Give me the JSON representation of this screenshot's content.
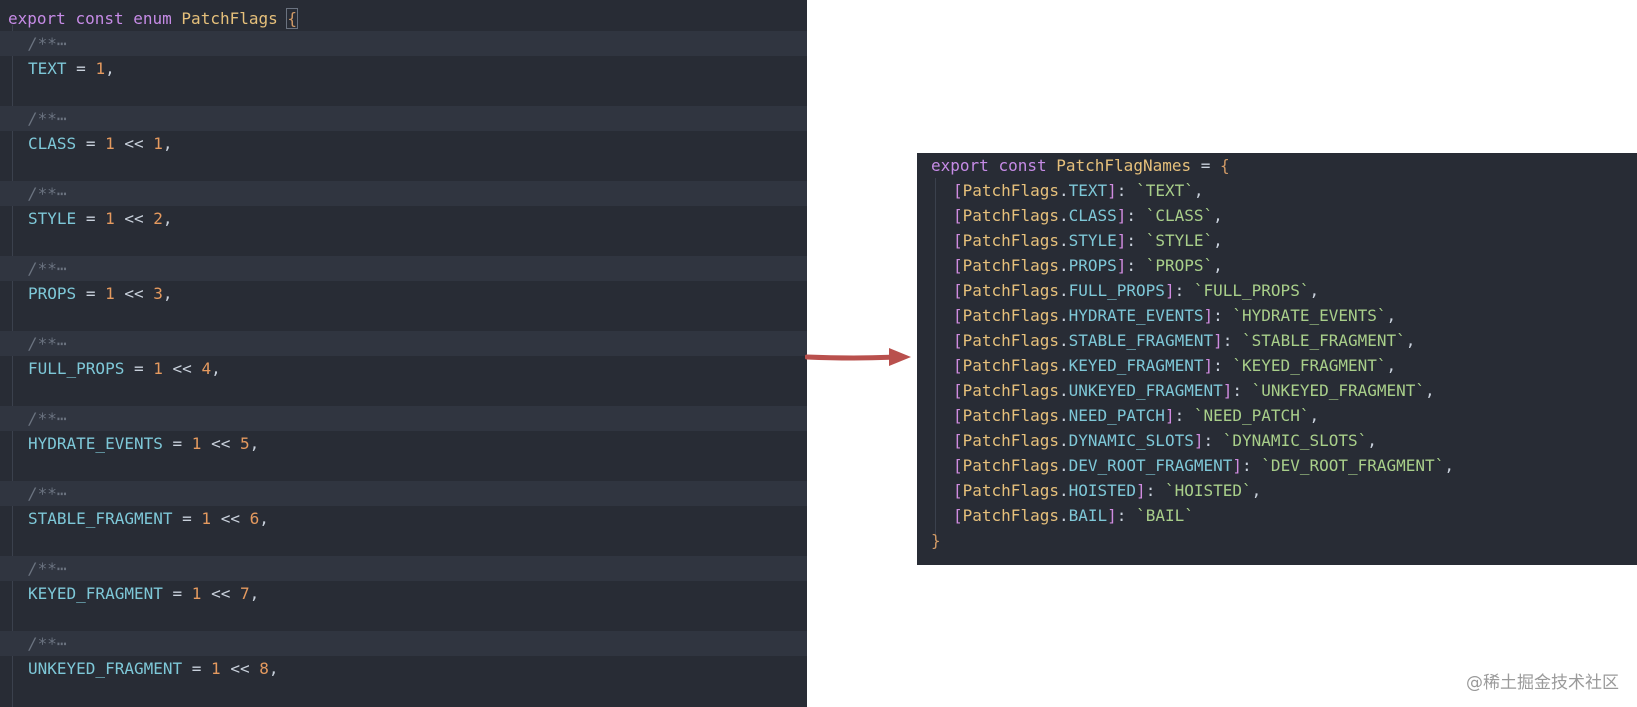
{
  "left_editor": {
    "decl": {
      "export": "export",
      "const": "const",
      "enum": "enum",
      "name": "PatchFlags",
      "brace": "{"
    },
    "members": [
      {
        "comment": "/**⋯",
        "name": "TEXT",
        "value": "1",
        "op": "",
        "shift": "",
        "comma": ","
      },
      {
        "comment": "/**⋯",
        "name": "CLASS",
        "value": "1",
        "op": "<<",
        "shift": "1",
        "comma": ","
      },
      {
        "comment": "/**⋯",
        "name": "STYLE",
        "value": "1",
        "op": "<<",
        "shift": "2",
        "comma": ","
      },
      {
        "comment": "/**⋯",
        "name": "PROPS",
        "value": "1",
        "op": "<<",
        "shift": "3",
        "comma": ","
      },
      {
        "comment": "/**⋯",
        "name": "FULL_PROPS",
        "value": "1",
        "op": "<<",
        "shift": "4",
        "comma": ","
      },
      {
        "comment": "/**⋯",
        "name": "HYDRATE_EVENTS",
        "value": "1",
        "op": "<<",
        "shift": "5",
        "comma": ","
      },
      {
        "comment": "/**⋯",
        "name": "STABLE_FRAGMENT",
        "value": "1",
        "op": "<<",
        "shift": "6",
        "comma": ","
      },
      {
        "comment": "/**⋯",
        "name": "KEYED_FRAGMENT",
        "value": "1",
        "op": "<<",
        "shift": "7",
        "comma": ","
      },
      {
        "comment": "/**⋯",
        "name": "UNKEYED_FRAGMENT",
        "value": "1",
        "op": "<<",
        "shift": "8",
        "comma": ","
      }
    ]
  },
  "right_editor": {
    "decl": {
      "export": "export",
      "const": "const",
      "name": "PatchFlagNames",
      "eq": "=",
      "brace": "{"
    },
    "object": "PatchFlags",
    "entries": [
      {
        "key": "TEXT",
        "value": "`TEXT`",
        "comma": ","
      },
      {
        "key": "CLASS",
        "value": "`CLASS`",
        "comma": ","
      },
      {
        "key": "STYLE",
        "value": "`STYLE`",
        "comma": ","
      },
      {
        "key": "PROPS",
        "value": "`PROPS`",
        "comma": ","
      },
      {
        "key": "FULL_PROPS",
        "value": "`FULL_PROPS`",
        "comma": ","
      },
      {
        "key": "HYDRATE_EVENTS",
        "value": "`HYDRATE_EVENTS`",
        "comma": ","
      },
      {
        "key": "STABLE_FRAGMENT",
        "value": "`STABLE_FRAGMENT`",
        "comma": ","
      },
      {
        "key": "KEYED_FRAGMENT",
        "value": "`KEYED_FRAGMENT`",
        "comma": ","
      },
      {
        "key": "UNKEYED_FRAGMENT",
        "value": "`UNKEYED_FRAGMENT`",
        "comma": ","
      },
      {
        "key": "NEED_PATCH",
        "value": "`NEED_PATCH`",
        "comma": ","
      },
      {
        "key": "DYNAMIC_SLOTS",
        "value": "`DYNAMIC_SLOTS`",
        "comma": ","
      },
      {
        "key": "DEV_ROOT_FRAGMENT",
        "value": "`DEV_ROOT_FRAGMENT`",
        "comma": ","
      },
      {
        "key": "HOISTED",
        "value": "`HOISTED`",
        "comma": ","
      },
      {
        "key": "BAIL",
        "value": "`BAIL`",
        "comma": ""
      }
    ],
    "close": "}"
  },
  "arrow": {
    "icon": "right-arrow-icon",
    "color": "#b9504d"
  },
  "watermark": "@稀土掘金技术社区",
  "colors": {
    "editor_bg": "#282c35",
    "keyword": "#c68be6",
    "type": "#e6c07b",
    "identifier": "#7ec8d8",
    "number": "#e59a5f",
    "string": "#a9cf8a",
    "comment": "#6b7380"
  }
}
